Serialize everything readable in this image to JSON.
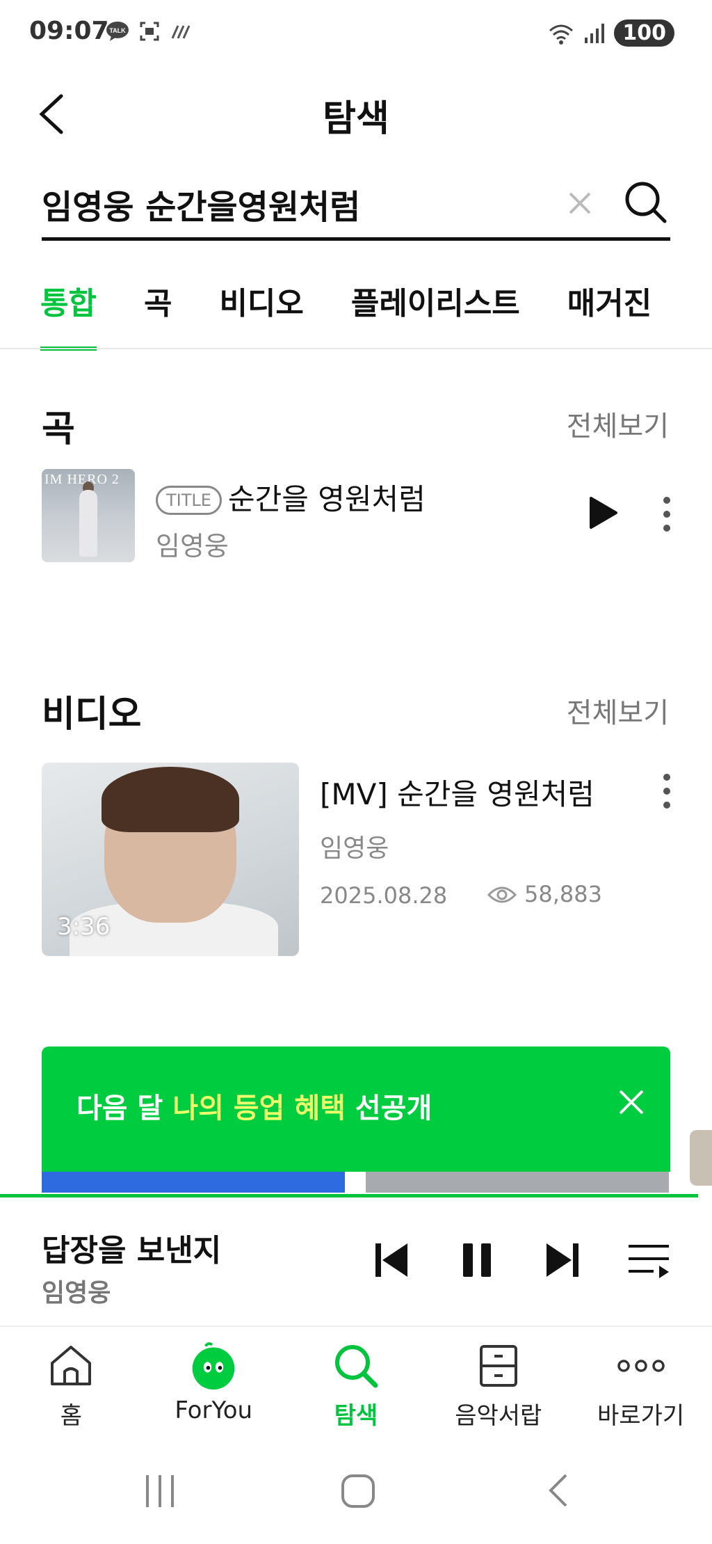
{
  "status_bar": {
    "time": "09:07",
    "battery": "100"
  },
  "header": {
    "title": "탐색"
  },
  "search": {
    "query": "임영웅 순간을영원처럼"
  },
  "tabs": [
    {
      "label": "통합",
      "active": true
    },
    {
      "label": "곡",
      "active": false
    },
    {
      "label": "비디오",
      "active": false
    },
    {
      "label": "플레이리스트",
      "active": false
    },
    {
      "label": "매거진",
      "active": false
    }
  ],
  "songs_section": {
    "title": "곡",
    "see_all": "전체보기",
    "items": [
      {
        "album_art_text": "IM HERO 2",
        "badge": "TITLE",
        "title": "순간을 영원처럼",
        "artist": "임영웅"
      }
    ]
  },
  "videos_section": {
    "title": "비디오",
    "see_all": "전체보기",
    "items": [
      {
        "title": "[MV] 순간을 영원처럼",
        "artist": "임영웅",
        "date": "2025.08.28",
        "views": "58,883",
        "duration": "3:36"
      }
    ]
  },
  "banner": {
    "text_before": "다음 달 ",
    "text_highlight": "나의 등업 혜택",
    "text_after": " 선공개",
    "background_color": "#00cc3f",
    "highlight_color": "#eaff6a"
  },
  "player": {
    "title": "답장을 보낸지",
    "artist": "임영웅"
  },
  "bottom_nav": [
    {
      "label": "홈",
      "icon": "home-icon",
      "active": false
    },
    {
      "label": "ForYou",
      "icon": "foryou-icon",
      "active": false
    },
    {
      "label": "탐색",
      "icon": "search-icon",
      "active": true
    },
    {
      "label": "음악서랍",
      "icon": "drawer-icon",
      "active": false
    },
    {
      "label": "바로가기",
      "icon": "more-icon",
      "active": false
    }
  ],
  "colors": {
    "accent": "#00c43e"
  }
}
